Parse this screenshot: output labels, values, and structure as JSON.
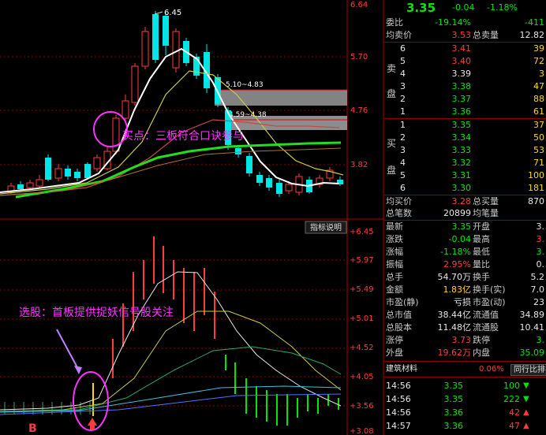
{
  "main_chart": {
    "price_ticks": [
      "6.64",
      "5.70",
      "4.76",
      "3.82"
    ],
    "high_marker": "6.45",
    "box1_label": "5.10~4.83",
    "box2_label": "4.59~4.38",
    "buy_annotation": "买点：三板符合口诀参与"
  },
  "sub_chart": {
    "button_label": "指标说明",
    "ticks": [
      "6.45",
      "5.97",
      "5.49",
      "5.01",
      "4.52",
      "4.05",
      "3.56",
      "3.08"
    ],
    "select_annotation": "选股：首板提供捉妖信号股关注",
    "signal_letter": "B"
  },
  "quote": {
    "price": "3.35",
    "change": "-0.04",
    "change_pct": "-1.18%",
    "wei_label": "委比",
    "wei_value": "-19.14%",
    "wei_diff": "-411",
    "ask_avg_label": "均卖价",
    "ask_avg": "3.53",
    "ask_total_label": "总卖量",
    "ask_total": "12.82",
    "sell_side_label": [
      "卖",
      "盘"
    ],
    "buy_side_label": [
      "买",
      "盘"
    ],
    "asks": [
      {
        "level": "6",
        "price": "3.41",
        "vol": "39"
      },
      {
        "level": "5",
        "price": "3.40",
        "vol": "72"
      },
      {
        "level": "4",
        "price": "3.39",
        "vol": "3"
      },
      {
        "level": "3",
        "price": "3.38",
        "vol": "47"
      },
      {
        "level": "2",
        "price": "3.37",
        "vol": "88"
      },
      {
        "level": "1",
        "price": "3.36",
        "vol": "61"
      }
    ],
    "bids": [
      {
        "level": "1",
        "price": "3.35",
        "vol": "37"
      },
      {
        "level": "2",
        "price": "3.34",
        "vol": "50"
      },
      {
        "level": "3",
        "price": "3.33",
        "vol": "53"
      },
      {
        "level": "4",
        "price": "3.32",
        "vol": "71"
      },
      {
        "level": "5",
        "price": "3.31",
        "vol": "100"
      },
      {
        "level": "6",
        "price": "3.30",
        "vol": "181"
      }
    ],
    "bid_avg_label": "均买价",
    "bid_avg": "3.28",
    "bid_total_label": "总买量",
    "bid_total": "870",
    "trades_label": "总笔数",
    "trades": "20899",
    "avg_vol_label": "均笔量",
    "stats": [
      {
        "l1": "最新",
        "v1": "3.35",
        "l2": "开盘",
        "v2": "3."
      },
      {
        "l1": "涨跌",
        "v1": "-0.04",
        "l2": "最高",
        "v2": "3."
      },
      {
        "l1": "涨幅",
        "v1": "-1.18%",
        "l2": "最低",
        "v2": "3."
      },
      {
        "l1": "振幅",
        "v1": "2.95%",
        "l2": "量比",
        "v2": "0."
      },
      {
        "l1": "总手",
        "v1": "54.70万",
        "l2": "换手",
        "v2": "5.2"
      },
      {
        "l1": "金额",
        "v1": "1.83亿",
        "l2": "换手(实)",
        "v2": "7.0"
      },
      {
        "l1": "市盈(静)",
        "v1": "亏损",
        "l2": "市盈(动)",
        "v2": "23"
      },
      {
        "l1": "总市值",
        "v1": "38.44亿",
        "l2": "流通值",
        "v2": "34.89"
      },
      {
        "l1": "总股本",
        "v1": "11.48亿",
        "l2": "流通股",
        "v2": "10.41"
      },
      {
        "l1": "涨停",
        "v1": "3.73",
        "l2": "跌停",
        "v2": "3."
      },
      {
        "l1": "外盘",
        "v1": "19.62万",
        "l2": "内盘",
        "v2": "35.09"
      }
    ],
    "sector_name": "建筑材料",
    "sector_pct": "0.06%",
    "sector_button": "同行比排名",
    "ticks": [
      {
        "time": "14:56",
        "price": "3.35",
        "vol": "100",
        "dir": "down"
      },
      {
        "time": "14:56",
        "price": "3.35",
        "vol": "222",
        "dir": "down"
      },
      {
        "time": "14:56",
        "price": "3.36",
        "vol": "42",
        "dir": "up"
      },
      {
        "time": "14:57",
        "price": "3.36",
        "vol": "47",
        "dir": "up"
      }
    ]
  },
  "colors": {
    "up": "#ff3b3b",
    "down": "#00e6e6",
    "ma_green": "#22dd22",
    "annot": "#ff33ff"
  }
}
